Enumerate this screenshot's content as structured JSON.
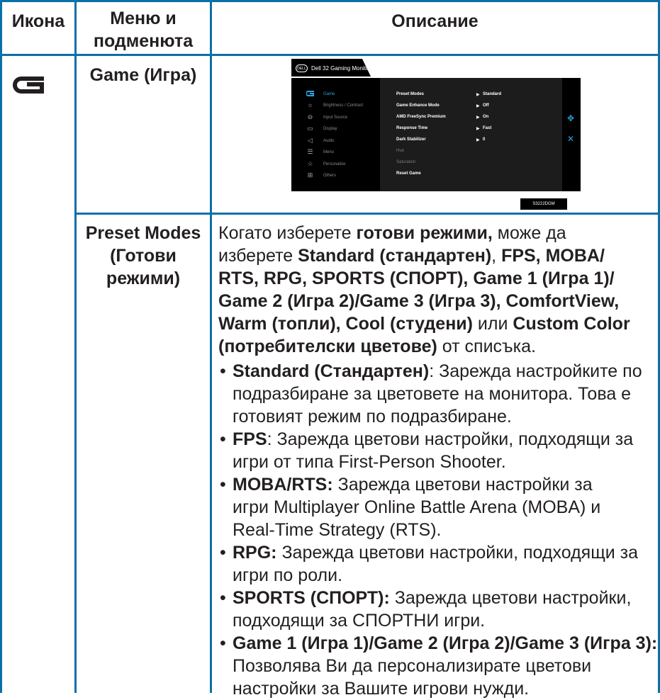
{
  "table": {
    "headers": {
      "icon": "Икона",
      "menu_line1": "Меню и",
      "menu_line2": "подменюта",
      "description": "Описание"
    }
  },
  "row_game": {
    "icon": "game-icon",
    "menu": "Game (Игра)",
    "osd": {
      "header_title": "Dell 32 Gaming Monitor",
      "logo": "DELL",
      "menu_items": [
        {
          "label": "Game",
          "icon": "game-icon",
          "active": true
        },
        {
          "label": "Brightness / Contrast",
          "icon": "brightness-icon"
        },
        {
          "label": "Input Source",
          "icon": "input-source-icon"
        },
        {
          "label": "Display",
          "icon": "display-icon"
        },
        {
          "label": "Audio",
          "icon": "audio-icon"
        },
        {
          "label": "Menu",
          "icon": "menu-icon"
        },
        {
          "label": "Personalize",
          "icon": "personalize-icon"
        },
        {
          "label": "Others",
          "icon": "others-icon"
        }
      ],
      "options": [
        {
          "label": "Preset Modes",
          "value": "Standard"
        },
        {
          "label": "Game Enhance Mode",
          "value": "Off"
        },
        {
          "label": "AMD FreeSync Premium",
          "value": "On"
        },
        {
          "label": "Response Time",
          "value": "Fast"
        },
        {
          "label": "Dark Stabilizer",
          "value": "0"
        },
        {
          "label": "Hue",
          "value": ""
        },
        {
          "label": "Saturation",
          "value": ""
        },
        {
          "label": "Reset Game",
          "value": ""
        }
      ],
      "model": "S3222DGM",
      "controls": [
        "move-icon",
        "close-icon"
      ]
    }
  },
  "row_preset": {
    "menu_line1": "Preset Modes",
    "menu_line2": "(Готови",
    "menu_line3": "режими)",
    "intro": {
      "p1": "Когато изберете ",
      "b1": "готови режими,",
      "p2": " може да",
      "p3": "изберете ",
      "b2": "Standard (стандартен)",
      "p4": ", ",
      "b3": "FPS, MOBA/",
      "b4": "RTS, RPG, SPORTS (СПОРТ), Game 1 (Игра 1)/",
      "b5": "Game 2 (Игра 2)/Game 3 (Игра 3), ComfortView,",
      "b6": "Warm (топли), Cool (студени)",
      "p5": " или ",
      "b7": "Custom Color",
      "b8": "(потребителски цветове)",
      "p6": " от списъка."
    },
    "bullets": [
      {
        "bold": "Standard (Стандартен)",
        "text": ": Зарежда настройките по подразбиране за цветовете на монитора. Това е готовият режим по подразбиране."
      },
      {
        "bold": "FPS",
        "text": ": Зарежда цветови настройки, подходящи за игри от типа First-Person Shooter."
      },
      {
        "bold": "MOBA/RTS:",
        "text": " Зарежда цветови настройки за игри Multiplayer Online Battle Arena (MOBA) и Real-Time Strategy (RTS)."
      },
      {
        "bold": "RPG:",
        "text": " Зарежда цветови настройки, подходящи за игри по роли."
      },
      {
        "bold": "SPORTS (СПОРТ):",
        "text": " Зарежда цветови настройки, подходящи за СПОРТНИ игри."
      },
      {
        "bold": "Game 1 (Игра 1)/Game 2 (Игра 2)/Game 3 (Игра 3):",
        "text": " Позволява Ви да персонализирате цветови настройки за Вашите игрови нужди."
      }
    ]
  },
  "colors": {
    "border": "#0b6fa8",
    "osd_accent": "#2aa4e3",
    "osd_bg": "#000000",
    "text": "#231f20"
  }
}
